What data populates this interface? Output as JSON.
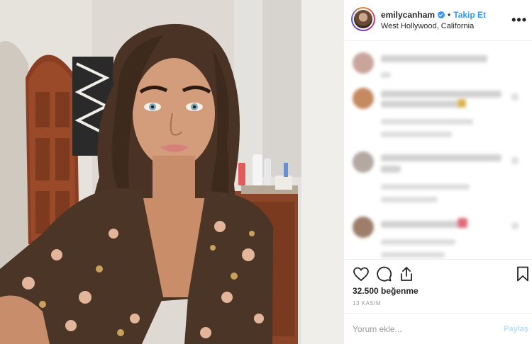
{
  "header": {
    "username": "emilycanham",
    "follow_label": "Takip Et",
    "separator": "•",
    "location": "West Hollywood, California",
    "more_label": "•••"
  },
  "post": {
    "likes_text": "32.500 beğenme",
    "date": "13 KASIM"
  },
  "comment_box": {
    "placeholder": "Yorum ekle...",
    "post_label": "Paylaş"
  },
  "colors": {
    "accent": "#3897f0",
    "text": "#262626",
    "muted": "#999999",
    "border": "#efefef"
  },
  "icons": [
    "verified-icon",
    "heart-icon",
    "comment-icon",
    "share-icon",
    "bookmark-icon",
    "more-icon"
  ]
}
